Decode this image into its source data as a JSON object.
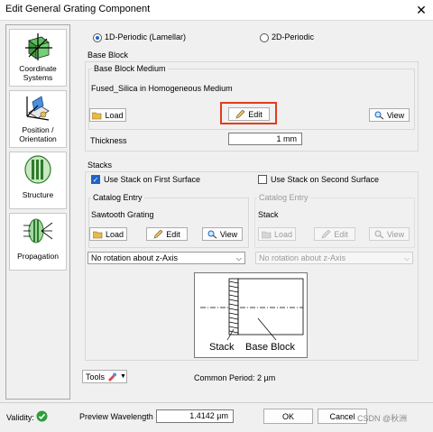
{
  "window": {
    "title": "Edit General Grating Component",
    "close_glyph": "✕"
  },
  "nav": [
    {
      "label": "Coordinate Systems",
      "icon": "coordinate-systems-icon"
    },
    {
      "label": "Position / Orientation",
      "icon": "position-orientation-icon"
    },
    {
      "label": "Structure",
      "icon": "structure-icon"
    },
    {
      "label": "Propagation",
      "icon": "propagation-icon"
    }
  ],
  "periodicity": {
    "option_1d": "1D-Periodic (Lamellar)",
    "option_2d": "2D-Periodic",
    "selected": "1D-Periodic (Lamellar)"
  },
  "base_block": {
    "section_label": "Base Block",
    "medium_group_label": "Base Block Medium",
    "medium_value": "Fused_Silica in Homogeneous Medium",
    "load_label": "Load",
    "edit_label": "Edit",
    "view_label": "View",
    "thickness_label": "Thickness",
    "thickness_value": "1 mm"
  },
  "stacks": {
    "section_label": "Stacks",
    "first_surface": {
      "label": "Use Stack on First Surface",
      "checked": true
    },
    "second_surface": {
      "label": "Use Stack on Second Surface",
      "checked": false
    },
    "first_catalog": {
      "label": "Catalog Entry",
      "value": "Sawtooth Grating",
      "load_label": "Load",
      "edit_label": "Edit",
      "view_label": "View",
      "rotation": "No rotation about z-Axis"
    },
    "second_catalog": {
      "label": "Catalog Entry",
      "value": "Stack",
      "load_label": "Load",
      "edit_label": "Edit",
      "view_label": "View",
      "rotation": "No rotation about z-Axis"
    },
    "diagram": {
      "stack_label": "Stack",
      "base_block_label": "Base Block"
    }
  },
  "tools": {
    "label": "Tools",
    "common_period": "Common Period: 2 µm"
  },
  "footer": {
    "validity_label": "Validity:",
    "preview_wavelength_label": "Preview Wavelength",
    "preview_wavelength_value": "1.4142 µm",
    "ok_label": "OK",
    "cancel_label": "Cancel",
    "watermark": "CSDN @秋洲"
  },
  "colors": {
    "highlight": "#e03c1f",
    "accent": "#1e63c6",
    "validity_ok": "#2e9d3a"
  }
}
